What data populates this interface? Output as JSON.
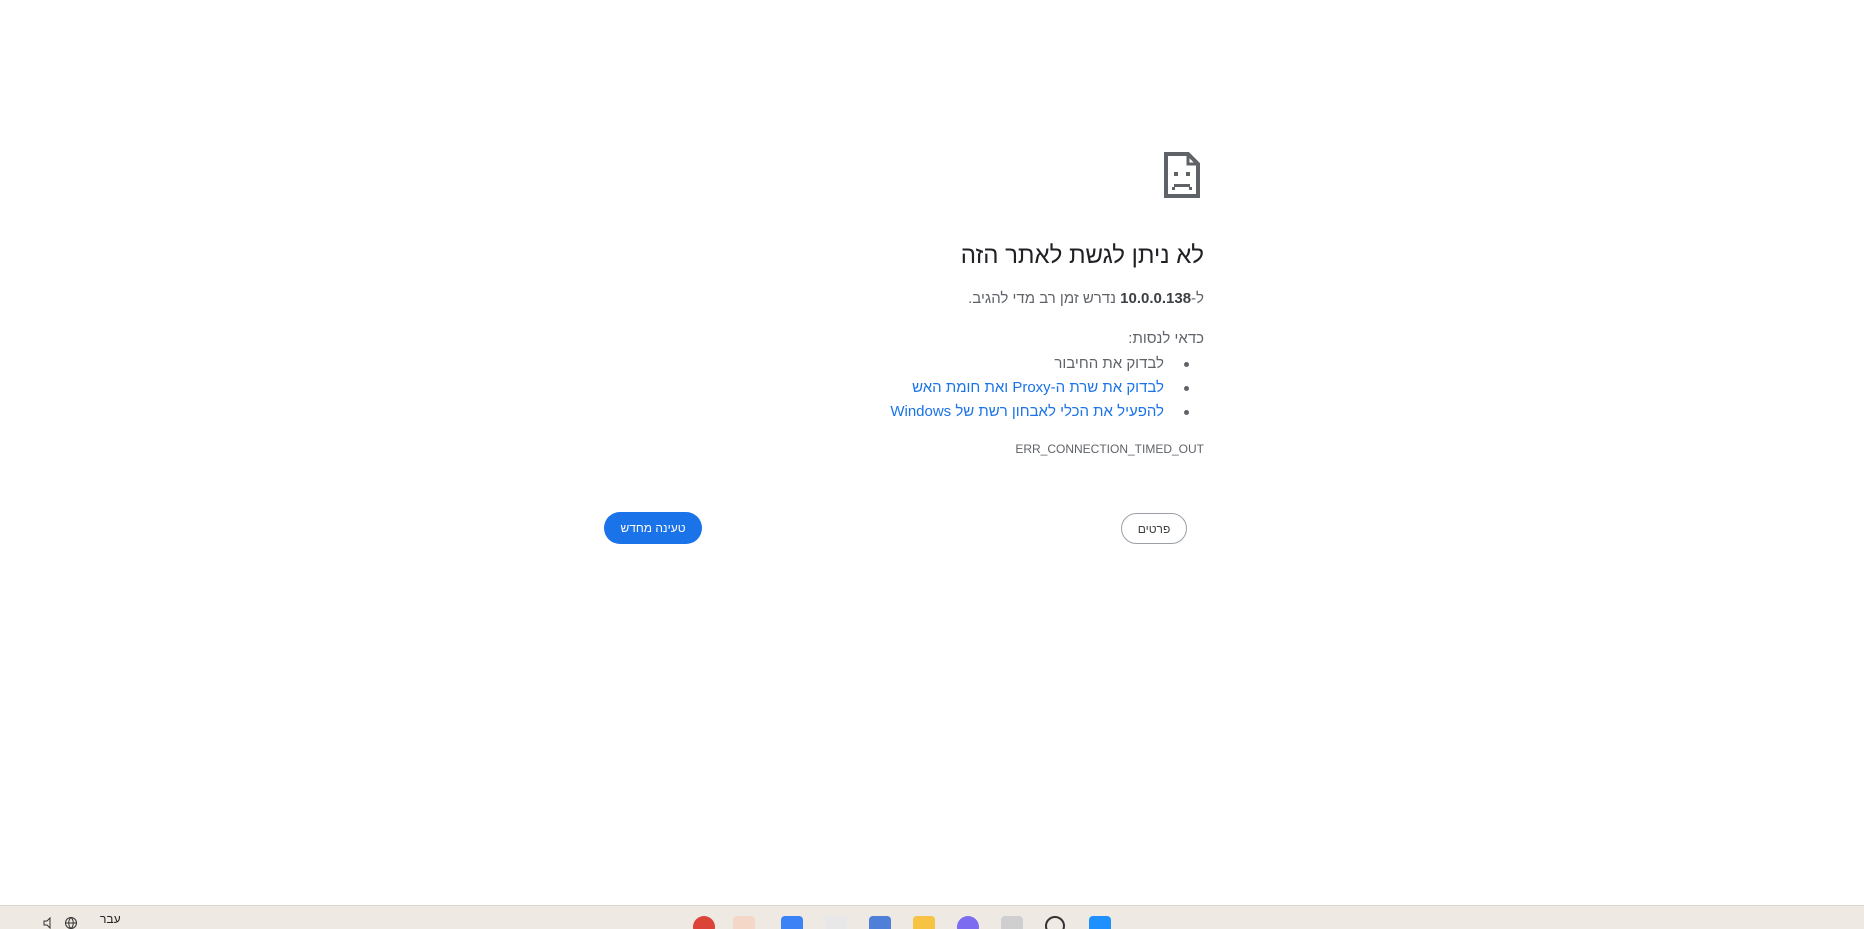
{
  "error_page": {
    "title": "לא ניתן לגשת לאתר הזה",
    "desc_prefix": "ל-",
    "host": "10.0.0.138",
    "desc_suffix": " נדרש זמן רב מדי להגיב.",
    "try_label": "כדאי לנסות:",
    "suggestions": [
      "לבדוק את החיבור",
      "לבדוק את שרת ה-Proxy ואת חומת האש",
      "להפעיל את הכלי לאבחון רשת של Windows"
    ],
    "error_code": "ERR_CONNECTION_TIMED_OUT",
    "details_label": "פרטים",
    "reload_label": "טעינה מחדש"
  },
  "taskbar": {
    "language": "עבר",
    "icons": [
      "chrome-icon",
      "user-profile-icon",
      "settings-app-icon",
      "paint-icon",
      "file-app-icon",
      "folder-icon",
      "copilot-icon",
      "taskview-icon",
      "search-icon",
      "start-icon"
    ],
    "colors": {
      "chrome": "#db4437",
      "folder": "#f6c342",
      "store": "#3b82f6",
      "start": "#1e90ff"
    }
  }
}
